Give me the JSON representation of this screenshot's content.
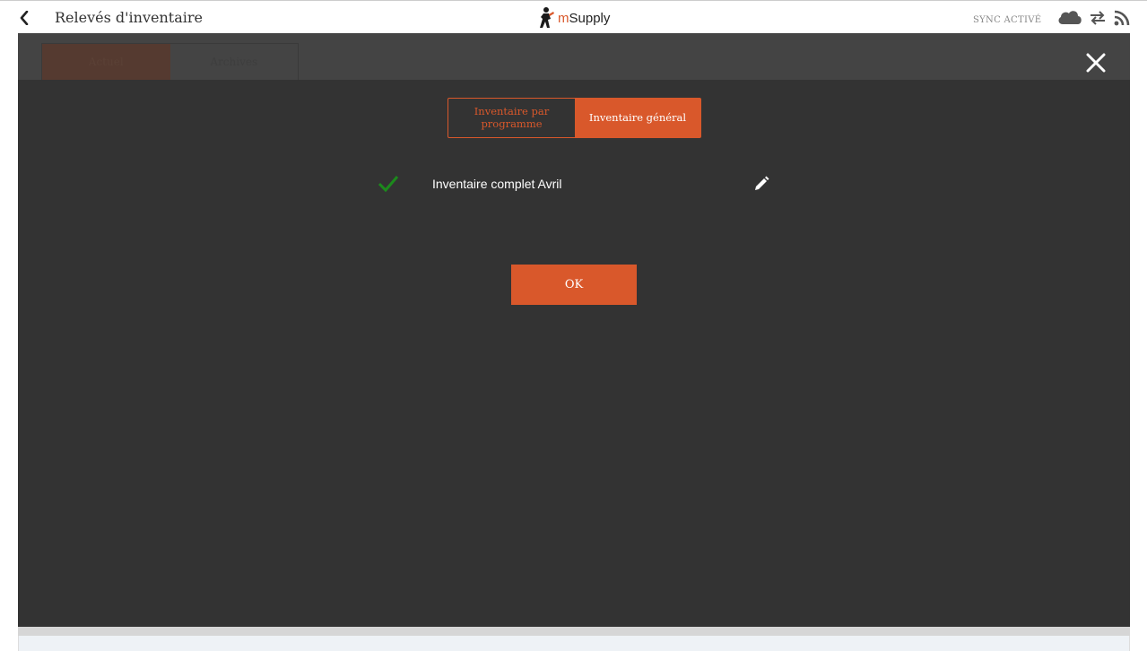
{
  "header": {
    "title": "Relevés d'inventaire",
    "logo_m": "m",
    "logo_rest": "Supply",
    "sync_status": "SYNC ACTIVÉ"
  },
  "background_page": {
    "tabs": [
      "Actuel",
      "Archives"
    ]
  },
  "modal": {
    "toggle": {
      "left_label": "Inventaire par programme",
      "right_label": "Inventaire général"
    },
    "item": {
      "label": "Inventaire complet Avril"
    },
    "ok_label": "OK"
  },
  "colors": {
    "accent": "#d9582b",
    "modal_bg": "#333333",
    "check": "#1c8a1c"
  },
  "icons": {
    "back": "chevron-left-icon",
    "cloud": "cloud-icon",
    "sync": "sync-arrows-icon",
    "feed": "rss-icon",
    "close": "close-icon",
    "check": "check-icon",
    "edit": "pencil-icon"
  }
}
